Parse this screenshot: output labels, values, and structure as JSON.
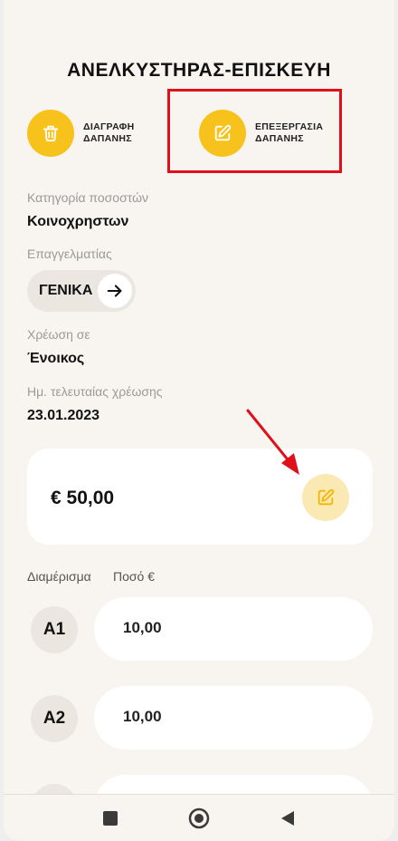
{
  "header": {
    "title": "ΑΝΕΛΚΥΣΤΗΡΑΣ-ΕΠΙΣΚΕΥΗ"
  },
  "actions": {
    "delete": {
      "line1": "ΔΙΑΓΡΑΦΗ",
      "line2": "ΔΑΠΑΝΗΣ",
      "icon": "trash-icon"
    },
    "edit": {
      "line1": "ΕΠΕΞΕΡΓΑΣΙΑ",
      "line2": "ΔΑΠΑΝΗΣ",
      "icon": "pencil-square-icon"
    }
  },
  "details": {
    "category_label": "Κατηγορία ποσοστών",
    "category_value": "Κοινοχρηστων",
    "professional_label": "Επαγγελματίας",
    "professional_value": "ΓΕΝΙΚΑ",
    "charge_label": "Χρέωση σε",
    "charge_value": "Ένοικος",
    "last_charge_label": "Ημ. τελευταίας χρέωσης",
    "last_charge_value": "23.01.2023"
  },
  "amount": {
    "total": "€ 50,00"
  },
  "table": {
    "col_apartment": "Διαμέρισμα",
    "col_amount": "Ποσό €",
    "rows": [
      {
        "apartment": "A1",
        "amount": "10,00"
      },
      {
        "apartment": "A2",
        "amount": "10,00"
      },
      {
        "apartment": "",
        "amount": ""
      }
    ]
  },
  "colors": {
    "accent": "#f7c21b",
    "accent_light": "#fbe9b4",
    "highlight": "#e0101a",
    "background": "#f8f5f0"
  },
  "navbar": {
    "icons": [
      "square-icon",
      "circle-home-icon",
      "triangle-back-icon"
    ]
  }
}
